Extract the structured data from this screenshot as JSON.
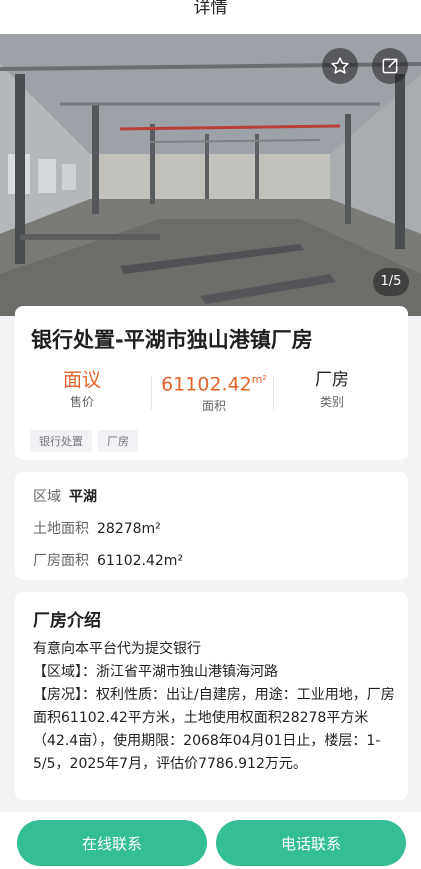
{
  "header": {
    "title": "详情"
  },
  "gallery": {
    "counter": "1/5"
  },
  "property": {
    "title": "银行处置-平湖市独山港镇厂房",
    "stats": [
      {
        "value": "面议",
        "unit": "",
        "label": "售价"
      },
      {
        "value": "61102.42",
        "unit": "m²",
        "label": "面积"
      },
      {
        "value": "厂房",
        "unit": "",
        "label": "类别"
      }
    ],
    "tags": [
      "银行处置",
      "厂房"
    ]
  },
  "info": {
    "region_label": "区域",
    "region_value": "平湖",
    "land_label": "土地面积",
    "land_value": "28278m²",
    "factory_label": "厂房面积",
    "factory_value": "61102.42m²"
  },
  "intro": {
    "title": "厂房介绍",
    "lines": [
      "有意向本平台代为提交银行",
      "【区域】：浙江省平湖市独山港镇海河路",
      "【房况】：权利性质：出让/自建房，用途：工业用地，厂房面积61102.42平方米，土地使用权面积28278平方米（42.4亩），使用期限：2068年04月01日止，楼层：1-5/5，2025年7月，评估价7786.912万元。"
    ]
  },
  "actions": {
    "online": "在线联系",
    "phone": "电话联系"
  },
  "colors": {
    "accent": "#35bd95",
    "price": "#e2642a"
  }
}
